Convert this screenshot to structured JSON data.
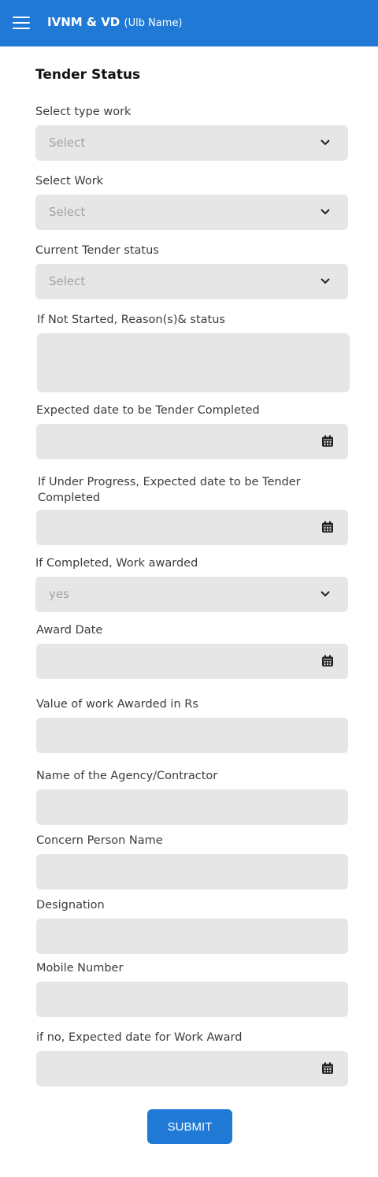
{
  "header": {
    "title": "IVNM & VD",
    "subtitle": "(Ulb Name)"
  },
  "form": {
    "title": "Tender Status",
    "type_work": {
      "label": "Select type work",
      "value": "Select"
    },
    "work": {
      "label": "Select Work",
      "value": "Select"
    },
    "current_status": {
      "label": "Current Tender status",
      "value": "Select"
    },
    "not_started": {
      "label": "If Not Started, Reason(s)& status"
    },
    "expected_date": {
      "label": "Expected date to be Tender Completed"
    },
    "under_progress": {
      "label": "If Under Progress, Expected date to be Tender Completed"
    },
    "work_awarded": {
      "label": "If Completed, Work awarded",
      "value": "yes"
    },
    "award_date": {
      "label": "Award Date"
    },
    "value_awarded": {
      "label": "Value of work Awarded in Rs"
    },
    "agency": {
      "label": "Name of the Agency/Contractor"
    },
    "concern_person": {
      "label": "Concern Person Name"
    },
    "designation": {
      "label": "Designation"
    },
    "mobile": {
      "label": "Mobile Number"
    },
    "expected_award": {
      "label": "if no, Expected date for Work Award"
    },
    "submit_label": "SUBMIT"
  },
  "icons": {
    "menu": "hamburger-icon",
    "dropdown": "chevron-down-icon",
    "date": "calendar-icon"
  },
  "colors": {
    "primary": "#2079d4",
    "field_bg": "#e6e6e6"
  }
}
